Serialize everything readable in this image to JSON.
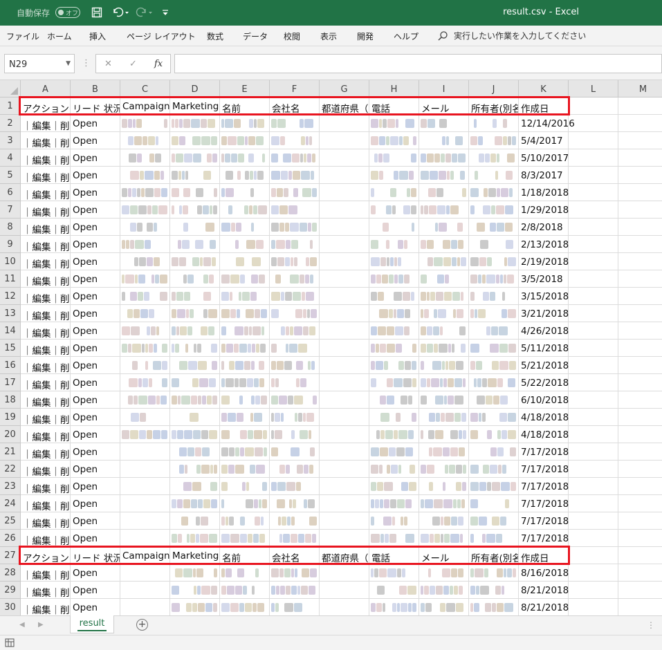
{
  "window": {
    "title": "result.csv  -  Excel"
  },
  "quick_access": {
    "autosave_label": "自動保存",
    "autosave_state": "オフ"
  },
  "menu": {
    "items": [
      "ファイル",
      "ホーム",
      "挿入",
      "ページ レイアウト",
      "数式",
      "データ",
      "校閲",
      "表示",
      "開発",
      "ヘルプ"
    ],
    "search_placeholder": "実行したい作業を入力してください"
  },
  "formula_bar": {
    "name_box": "N29",
    "fx_label": "fx",
    "cancel_glyph": "✕",
    "enter_glyph": "✓",
    "formula": ""
  },
  "columns": [
    "A",
    "B",
    "C",
    "D",
    "E",
    "F",
    "G",
    "H",
    "I",
    "J",
    "K",
    "L",
    "M"
  ],
  "header_row": {
    "A": "アクション",
    "B": "リード 状況",
    "C": "Campaign",
    "D": "Marketing",
    "E": "名前",
    "F": "会社名",
    "G": "都道府県（",
    "H": "電話",
    "I": "メール",
    "J": "所有者(別名)",
    "K": "作成日"
  },
  "rows": [
    {
      "n": "1",
      "header": true
    },
    {
      "n": "2",
      "a": "｜編集｜削除",
      "b": "Open",
      "k": "12/14/2016"
    },
    {
      "n": "3",
      "a": "｜編集｜削除",
      "b": "Open",
      "k": "5/4/2017"
    },
    {
      "n": "4",
      "a": "｜編集｜削除",
      "b": "Open",
      "k": "5/10/2017"
    },
    {
      "n": "5",
      "a": "｜編集｜削除",
      "b": "Open",
      "k": "8/3/2017"
    },
    {
      "n": "6",
      "a": "｜編集｜削除",
      "b": "Open",
      "k": "1/18/2018"
    },
    {
      "n": "7",
      "a": "｜編集｜削除",
      "b": "Open",
      "k": "1/29/2018"
    },
    {
      "n": "8",
      "a": "｜編集｜削除",
      "b": "Open",
      "k": "2/8/2018"
    },
    {
      "n": "9",
      "a": "｜編集｜削除",
      "b": "Open",
      "k": "2/13/2018"
    },
    {
      "n": "10",
      "a": "｜編集｜削除",
      "b": "Open",
      "k": "2/19/2018"
    },
    {
      "n": "11",
      "a": "｜編集｜削除",
      "b": "Open",
      "k": "3/5/2018"
    },
    {
      "n": "12",
      "a": "｜編集｜削除",
      "b": "Open",
      "k": "3/15/2018"
    },
    {
      "n": "13",
      "a": "｜編集｜削除",
      "b": "Open",
      "k": "3/21/2018"
    },
    {
      "n": "14",
      "a": "｜編集｜削除",
      "b": "Open",
      "k": "4/26/2018"
    },
    {
      "n": "15",
      "a": "｜編集｜削除",
      "b": "Open",
      "k": "5/11/2018"
    },
    {
      "n": "16",
      "a": "｜編集｜削除",
      "b": "Open",
      "k": "5/21/2018"
    },
    {
      "n": "17",
      "a": "｜編集｜削除",
      "b": "Open",
      "k": "5/22/2018"
    },
    {
      "n": "18",
      "a": "｜編集｜削除",
      "b": "Open",
      "k": "6/10/2018"
    },
    {
      "n": "19",
      "a": "｜編集｜削除",
      "b": "Open",
      "k": "4/18/2018"
    },
    {
      "n": "20",
      "a": "｜編集｜削除",
      "b": "Open",
      "k": "4/18/2018"
    },
    {
      "n": "21",
      "a": "｜編集｜削除",
      "b": "Open",
      "k": "7/17/2018"
    },
    {
      "n": "22",
      "a": "｜編集｜削除",
      "b": "Open",
      "k": "7/17/2018"
    },
    {
      "n": "23",
      "a": "｜編集｜削除",
      "b": "Open",
      "k": "7/17/2018"
    },
    {
      "n": "24",
      "a": "｜編集｜削除",
      "b": "Open",
      "k": "7/17/2018"
    },
    {
      "n": "25",
      "a": "｜編集｜削除",
      "b": "Open",
      "k": "7/17/2018"
    },
    {
      "n": "26",
      "a": "｜編集｜削除",
      "b": "Open",
      "k": "7/17/2018"
    },
    {
      "n": "27",
      "header": true
    },
    {
      "n": "28",
      "a": "｜編集｜削除",
      "b": "Open",
      "k": "8/16/2018"
    },
    {
      "n": "29",
      "a": "｜編集｜削除",
      "b": "Open",
      "k": "8/21/2018"
    },
    {
      "n": "30",
      "a": "｜編集｜削除",
      "b": "Open",
      "k": "8/21/2018"
    }
  ],
  "sheet_tabs": [
    "result"
  ],
  "colors": {
    "excel_green": "#217346",
    "highlight_red": "#e8141f"
  }
}
